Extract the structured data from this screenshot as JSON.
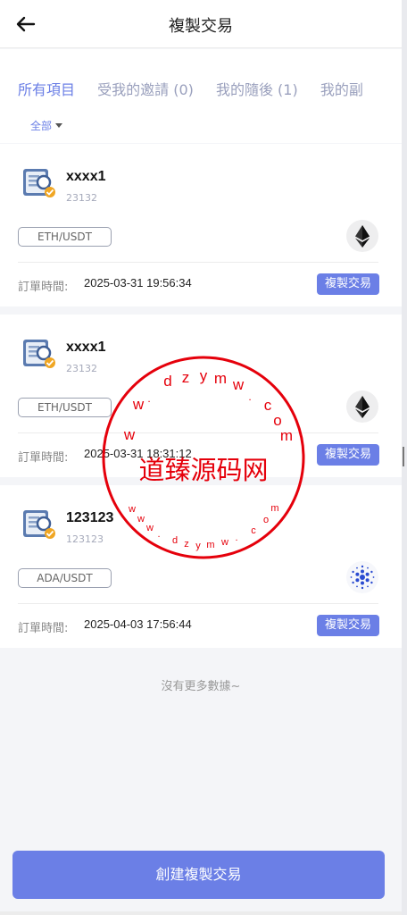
{
  "header": {
    "title": "複製交易"
  },
  "tabs": [
    {
      "label": "所有項目"
    },
    {
      "label": "受我的邀請 (0)"
    },
    {
      "label": "我的隨後 (1)"
    },
    {
      "label": "我的副"
    }
  ],
  "filter": {
    "label": "全部"
  },
  "cards": [
    {
      "name": "xxxx1",
      "uid": "23132",
      "pair": "ETH/USDT",
      "coin_icon": "ethereum-icon",
      "time_label": "訂單時間:",
      "time": "2025-03-31 19:56:34",
      "button": "複製交易"
    },
    {
      "name": "xxxx1",
      "uid": "23132",
      "pair": "ETH/USDT",
      "coin_icon": "ethereum-icon",
      "time_label": "訂單時間:",
      "time": "2025-03-31 18:31:12",
      "button": "複製交易"
    },
    {
      "name": "123123",
      "uid": "123123",
      "pair": "ADA/USDT",
      "coin_icon": "cardano-icon",
      "time_label": "訂單時間:",
      "time": "2025-04-03 17:56:44",
      "button": "複製交易"
    }
  ],
  "no_more": "沒有更多數據~",
  "create_button": "創建複製交易",
  "watermark": {
    "center_text": "道臻源码网",
    "ring_text": "www.dzymw.com",
    "color": "#e5000b"
  },
  "colors": {
    "accent": "#6b7fe6",
    "background": "#f4f5f8"
  }
}
